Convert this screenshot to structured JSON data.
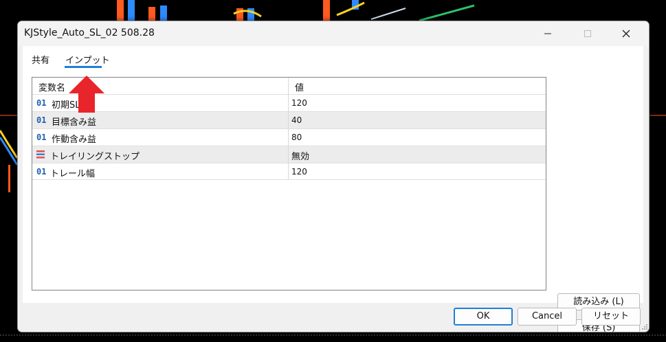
{
  "window": {
    "title": "KJStyle_Auto_SL_02 508.28"
  },
  "tabs": [
    {
      "label": "共有"
    },
    {
      "label": "インプット"
    }
  ],
  "grid": {
    "columns": {
      "name": "変数名",
      "value": "値"
    },
    "rows": [
      {
        "type": "01",
        "name": "初期SL",
        "value": "120"
      },
      {
        "type": "01",
        "name": "目標含み益",
        "value": "40"
      },
      {
        "type": "01",
        "name": "作動含み益",
        "value": "80"
      },
      {
        "type": "enum-icon",
        "name": "トレイリングストップ",
        "value": "無効"
      },
      {
        "type": "01",
        "name": "トレール幅",
        "value": "120"
      }
    ]
  },
  "side_buttons": {
    "load": "読み込み (L)",
    "save": "保存 (S)"
  },
  "footer": {
    "ok": "OK",
    "cancel": "Cancel",
    "reset": "リセット"
  },
  "colors": {
    "accent": "#1e7fd6",
    "arrow": "#e8252a"
  }
}
